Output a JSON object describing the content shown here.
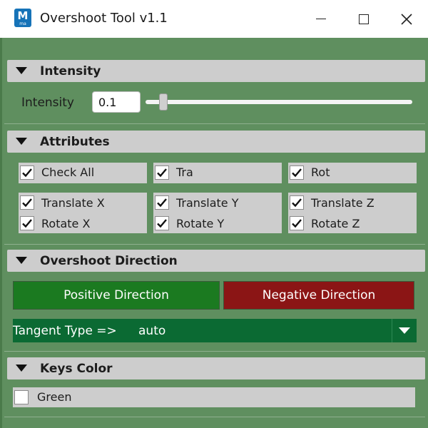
{
  "window": {
    "title": "Overshoot Tool v1.1",
    "app_icon_letter": "M",
    "app_icon_sub": "ma",
    "icons": {
      "minimize": "minimize-icon",
      "maximize": "maximize-icon",
      "close": "close-icon"
    }
  },
  "sections": {
    "intensity": "Intensity",
    "attributes": "Attributes",
    "direction": "Overshoot Direction",
    "keys_color": "Keys Color"
  },
  "intensity": {
    "label": "Intensity",
    "value": "0.1",
    "slider_fraction": 0.05
  },
  "attributes": {
    "check_all": {
      "label": "Check All",
      "checked": true
    },
    "tra": {
      "label": "Tra",
      "checked": true
    },
    "rot": {
      "label": "Rot",
      "checked": true
    },
    "translate_x": {
      "label": "Translate X",
      "checked": true
    },
    "translate_y": {
      "label": "Translate Y",
      "checked": true
    },
    "translate_z": {
      "label": "Translate Z",
      "checked": true
    },
    "rotate_x": {
      "label": "Rotate X",
      "checked": true
    },
    "rotate_y": {
      "label": "Rotate Y",
      "checked": true
    },
    "rotate_z": {
      "label": "Rotate Z",
      "checked": true
    }
  },
  "direction": {
    "positive_label": "Positive Direction",
    "negative_label": "Negative Direction",
    "positive_color": "#1b7a20",
    "negative_color": "#8b1515"
  },
  "tangent": {
    "label": "Tangent Type =>",
    "value": "auto",
    "color": "#0b6a33"
  },
  "keys_color": {
    "green": {
      "label": "Green",
      "checked": false
    }
  },
  "colors": {
    "background": "#5f8f5f",
    "header": "#cdcdcd"
  }
}
